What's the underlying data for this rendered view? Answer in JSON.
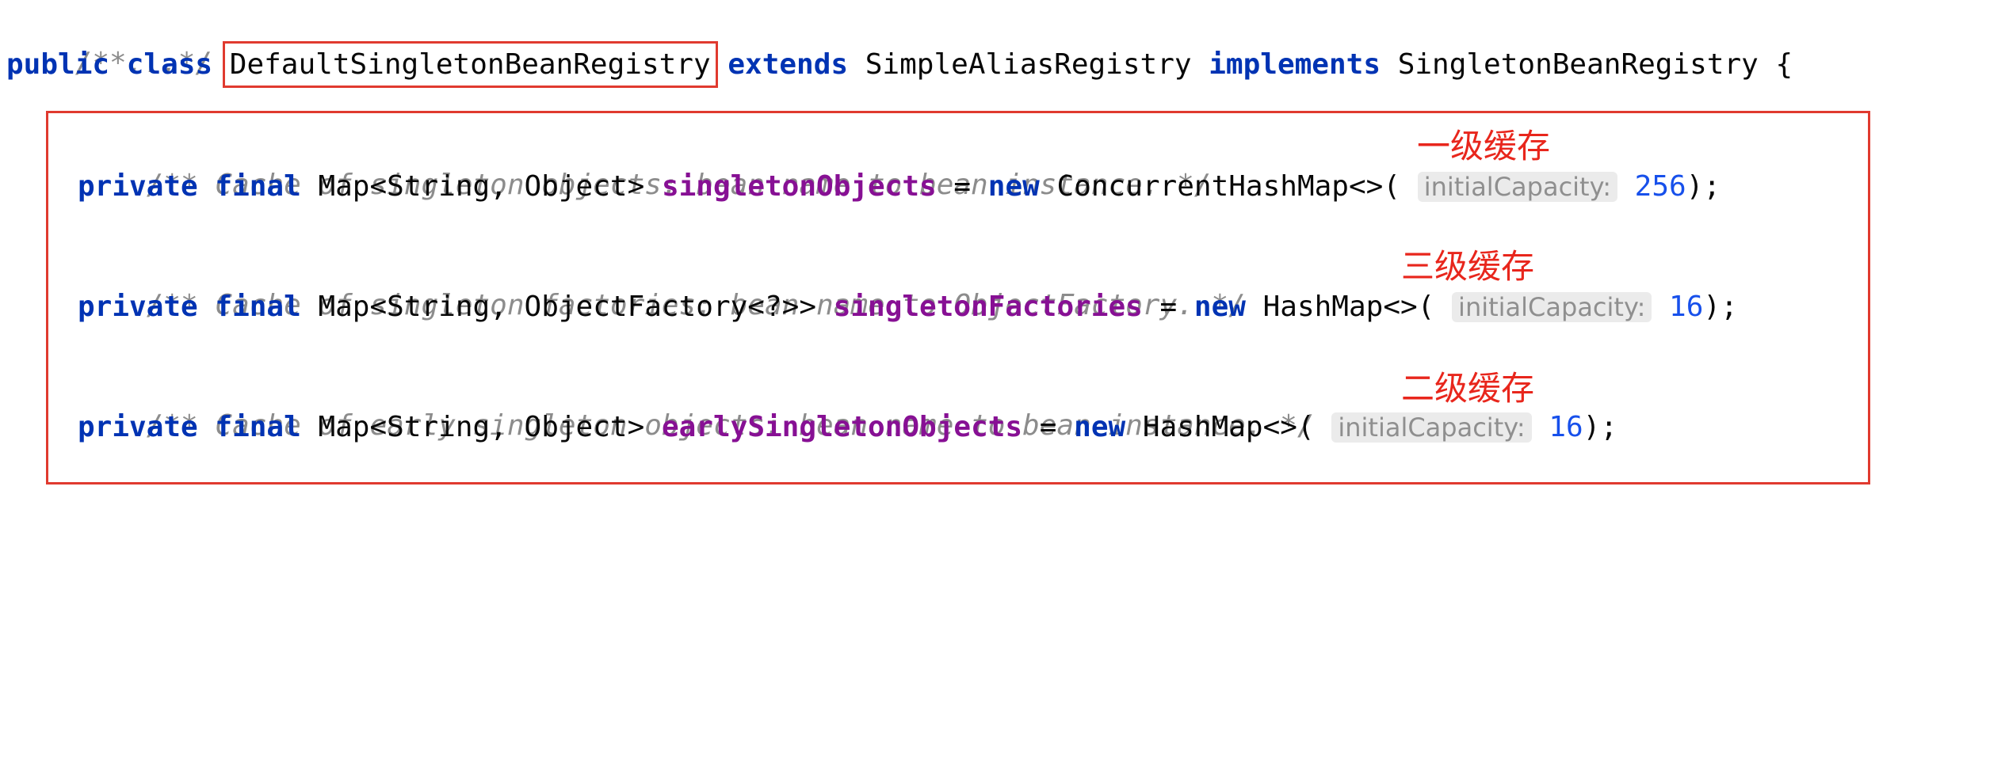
{
  "editor": {
    "folded_doc": "/**...*/",
    "class_decl": {
      "modifiers": "public class",
      "class_name": "DefaultSingletonBeanRegistry",
      "extends_kw": "extends",
      "parent": "SimpleAliasRegistry",
      "implements_kw": "implements",
      "interface": "SingletonBeanRegistry",
      "brace": "{"
    },
    "fields": [
      {
        "comment": "/** Cache of singleton objects: bean name to bean instance. */",
        "modifiers": "private final",
        "type": "Map<String, Object>",
        "name": "singletonObjects",
        "assign": "=",
        "new_kw": "new",
        "ctor": "ConcurrentHashMap<>(",
        "hint": "initialCapacity:",
        "value": "256",
        "end": ");",
        "cache_label": "一级缓存"
      },
      {
        "comment": "/** Cache of singleton factories: bean name to ObjectFactory. */",
        "modifiers": "private final",
        "type": "Map<String, ObjectFactory<?>>",
        "name": "singletonFactories",
        "assign": "=",
        "new_kw": "new",
        "ctor": "HashMap<>(",
        "hint": "initialCapacity:",
        "value": "16",
        "end": ");",
        "cache_label": "三级缓存"
      },
      {
        "comment": "/** Cache of early singleton objects: bean name to bean instance. */",
        "modifiers": "private final",
        "type": "Map<String, Object>",
        "name": "earlySingletonObjects",
        "assign": "=",
        "new_kw": "new",
        "ctor": "HashMap<>(",
        "hint": "initialCapacity:",
        "value": "16",
        "end": ");",
        "cache_label": "二级缓存"
      }
    ]
  },
  "colors": {
    "keyword": "#0033b3",
    "field": "#871094",
    "number": "#1750eb",
    "comment": "#8c8c8c",
    "annotation_red": "#e03a2f"
  }
}
